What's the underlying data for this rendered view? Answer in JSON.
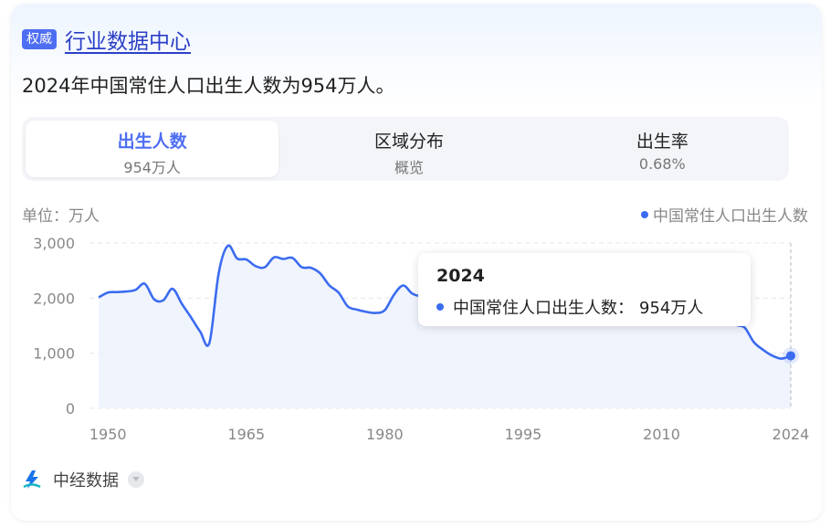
{
  "header": {
    "badge": "权威",
    "title": "行业数据中心"
  },
  "headline": "2024年中国常住人口出生人数为954万人。",
  "tabs": [
    {
      "label": "出生人数",
      "sub": "954万人",
      "active": true
    },
    {
      "label": "区域分布",
      "sub": "概览",
      "active": false
    },
    {
      "label": "出生率",
      "sub": "0.68%",
      "active": false
    }
  ],
  "unit_label": "单位：万人",
  "tooltip": {
    "title": "2024",
    "series_name": "中国常住人口出生人数",
    "separator": "：",
    "value_text": "954万人"
  },
  "footer": {
    "source": "中经数据"
  },
  "colors": {
    "accent": "#4e6ef2",
    "line": "#3b6cf0"
  },
  "chart_data": {
    "type": "line",
    "title": "",
    "xlabel": "",
    "ylabel": "单位：万人",
    "ylim": [
      0,
      3000
    ],
    "xlim": [
      1948,
      2024
    ],
    "y_ticks": [
      0,
      1000,
      2000,
      3000
    ],
    "y_tick_labels": [
      "0",
      "1,000",
      "2,000",
      "3,000"
    ],
    "x_ticks": [
      1950,
      1965,
      1980,
      1995,
      2010,
      2024
    ],
    "x_tick_labels": [
      "1950",
      "1965",
      "1980",
      "1995",
      "2010",
      "2024"
    ],
    "legend_position": "top-right",
    "grid": true,
    "series": [
      {
        "name": "中国常住人口出生人数",
        "x": [
          1949,
          1950,
          1951,
          1952,
          1953,
          1954,
          1955,
          1956,
          1957,
          1958,
          1959,
          1960,
          1961,
          1962,
          1963,
          1964,
          1965,
          1966,
          1967,
          1968,
          1969,
          1970,
          1971,
          1972,
          1973,
          1974,
          1975,
          1976,
          1977,
          1978,
          1979,
          1980,
          1981,
          1982,
          1983,
          1984,
          1985,
          1986,
          1987,
          1988,
          1989,
          1990,
          2016,
          2017,
          2018,
          2019,
          2020,
          2021,
          2022,
          2023,
          2024
        ],
        "y": [
          2013,
          2100,
          2110,
          2120,
          2150,
          2260,
          1980,
          1960,
          2170,
          1900,
          1650,
          1390,
          1190,
          2450,
          2950,
          2720,
          2700,
          2580,
          2560,
          2740,
          2710,
          2730,
          2560,
          2550,
          2450,
          2230,
          2100,
          1850,
          1790,
          1750,
          1730,
          1780,
          2060,
          2230,
          2080,
          2050,
          2200,
          2380,
          2520,
          2460,
          2400,
          2390,
          1883,
          1723,
          1523,
          1465,
          1202,
          1062,
          956,
          902,
          954
        ]
      }
    ],
    "highlight": {
      "x": 2024,
      "y": 954
    }
  }
}
